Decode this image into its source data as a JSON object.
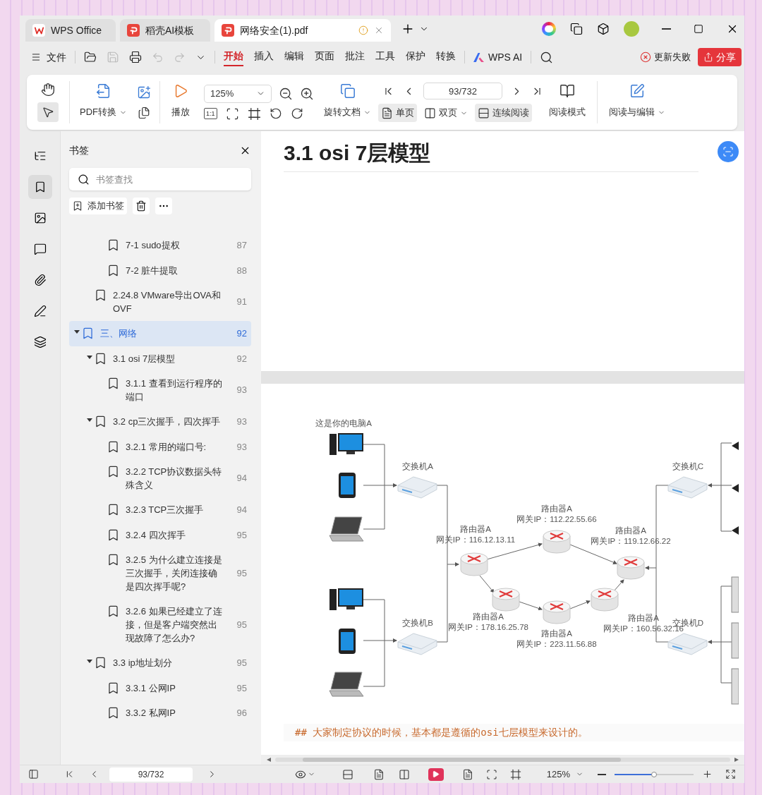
{
  "tabs": [
    {
      "label": "WPS Office",
      "selected": false
    },
    {
      "label": "稻壳AI模板",
      "selected": false
    },
    {
      "label": "网络安全(1).pdf",
      "selected": true
    }
  ],
  "menu": {
    "file": "文件",
    "items": [
      {
        "label": "开始",
        "selected": true
      },
      {
        "label": "插入",
        "selected": false
      },
      {
        "label": "编辑",
        "selected": false
      },
      {
        "label": "页面",
        "selected": false
      },
      {
        "label": "批注",
        "selected": false
      },
      {
        "label": "工具",
        "selected": false
      },
      {
        "label": "保护",
        "selected": false
      },
      {
        "label": "转换",
        "selected": false
      }
    ],
    "ai": "WPS AI",
    "update": "更新失败",
    "share": "分享"
  },
  "toolbar": {
    "convert": "PDF转换",
    "play": "播放",
    "zoom": "125%",
    "actual_size": "1:1",
    "rotate": "旋转文档",
    "page": "93/732",
    "views": [
      {
        "label": "单页",
        "selected": true
      },
      {
        "label": "双页",
        "selected": false
      },
      {
        "label": "连续阅读",
        "selected": true
      }
    ],
    "read_mode": "阅读模式",
    "read_edit": "阅读与编辑"
  },
  "rail": [
    {
      "selected": false
    },
    {
      "selected": true
    },
    {
      "selected": false
    },
    {
      "selected": false
    },
    {
      "selected": false
    },
    {
      "selected": false
    },
    {
      "selected": false
    }
  ],
  "bookmarks": {
    "title": "书签",
    "search": {
      "placeholder": "书签查找"
    },
    "add": "添加书签",
    "tree": [
      {
        "children": [
          {
            "children": [
              {
                "title": "7-1 sudo提权",
                "page": "87",
                "selected": false
              },
              {
                "title": "7-2 脏牛提取",
                "page": "88",
                "selected": false
              }
            ]
          },
          {
            "title": "2.24.8 VMware导出OVA和OVF",
            "page": "91",
            "selected": false
          }
        ]
      },
      {
        "title": "三、网络",
        "page": "92",
        "selected": true,
        "expanded": true,
        "children": [
          {
            "title": "3.1 osi 7层模型",
            "page": "92",
            "selected": false,
            "expanded": true,
            "children": [
              {
                "title": "3.1.1  查看到运行程序的端口",
                "page": "93",
                "selected": false
              }
            ]
          },
          {
            "title": "3.2  cp三次握手，四次挥手",
            "page": "93",
            "selected": false,
            "expanded": true,
            "children": [
              {
                "title": "3.2.1 常用的端口号:",
                "page": "93",
                "selected": false
              },
              {
                "title": "3.2.2 TCP协议数据头特殊含义",
                "page": "94",
                "selected": false
              },
              {
                "title": "3.2.3 TCP三次握手",
                "page": "94",
                "selected": false
              },
              {
                "title": "3.2.4 四次挥手",
                "page": "95",
                "selected": false
              },
              {
                "title": "3.2.5 为什么建立连接是三次握手，关闭连接确是四次挥手呢?",
                "page": "95",
                "selected": false
              },
              {
                "title": "3.2.6 如果已经建立了连接，但是客户端突然出现故障了怎么办?",
                "page": "95",
                "selected": false
              }
            ]
          },
          {
            "title": "3.3 ip地址划分",
            "page": "95",
            "selected": false,
            "expanded": true,
            "children": [
              {
                "title": "3.3.1 公网IP",
                "page": "95",
                "selected": false
              },
              {
                "title": "3.3.2 私网IP",
                "page": "96",
                "selected": false
              }
            ]
          }
        ]
      }
    ]
  },
  "document": {
    "heading": "3.1 osi 7层模型",
    "diagram": {
      "device_label": "这是你的电脑A",
      "switches": [
        "交换机A",
        "交换机B",
        "交换机C",
        "交换机D"
      ],
      "routers": [
        {
          "label": "路由器A",
          "ip": "网关IP：116.12.13.11"
        },
        {
          "label": "路由器A",
          "ip": "网关IP：112.22.55.66"
        },
        {
          "label": "路由器A",
          "ip": "网关IP：119.12.66.22"
        },
        {
          "label": "路由器A",
          "ip": "网关IP：178.16.25.78"
        },
        {
          "label": "路由器A",
          "ip": "网关IP：223.11.56.88"
        },
        {
          "label": "路由器A",
          "ip": "网关IP：160.56.32.16"
        }
      ]
    },
    "text": "## 大家制定协议的时候，基本都是遵循的osi七层模型来设计的。"
  },
  "status_bar": {
    "page": "93/732",
    "zoom": "125%",
    "zoom_slider": {
      "level": 0.5
    }
  }
}
